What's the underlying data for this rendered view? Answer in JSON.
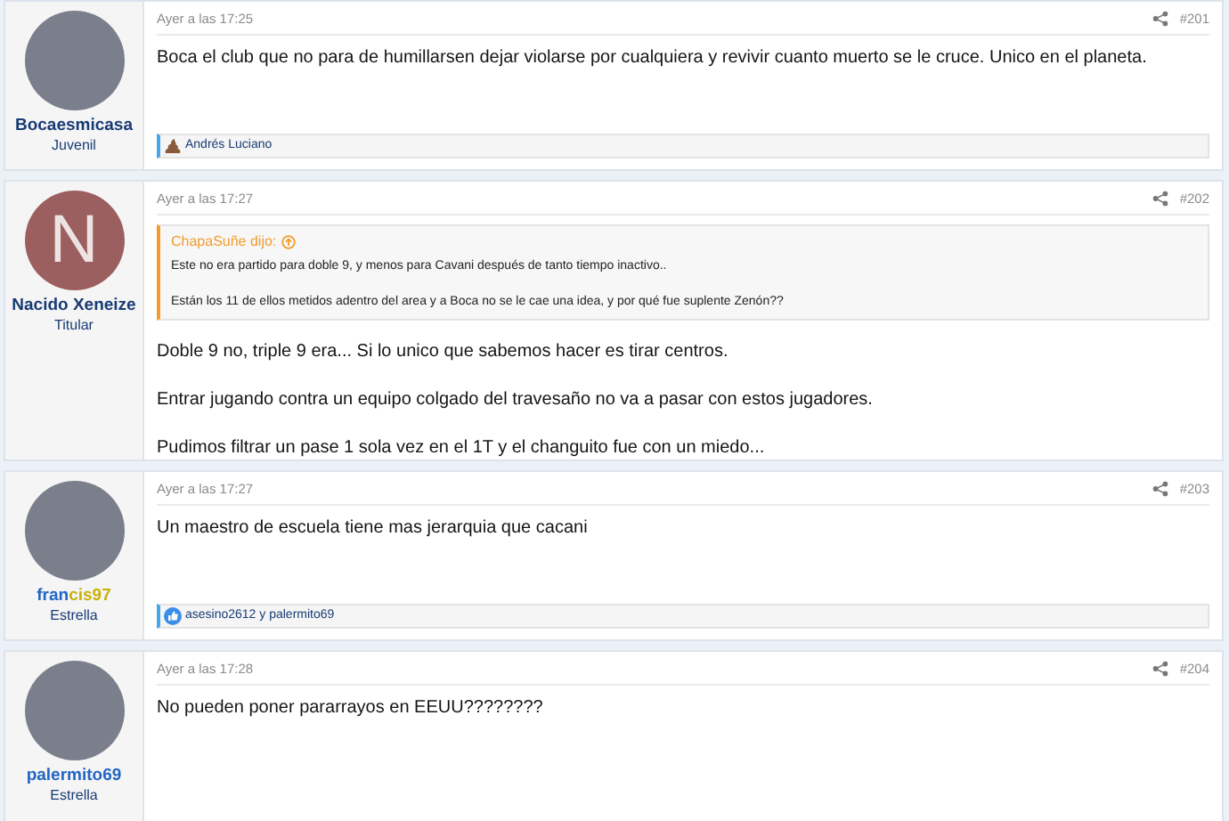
{
  "posts": [
    {
      "avatar": {
        "kind": "photo"
      },
      "username": [
        {
          "text": "Bocaesmicasa",
          "color": "#183b74"
        }
      ],
      "rank": "Juvenil",
      "time": "Ayer a las 17:25",
      "number": "#201",
      "paragraphs": [
        "Boca el club que no para de humillarsen dejar violarse por cualquiera y revivir cuanto muerto se le cruce. Unico en el planeta."
      ],
      "reactions": {
        "kind": "poo",
        "text": "Andrés Luciano"
      }
    },
    {
      "avatar": {
        "kind": "letter",
        "letter": "N"
      },
      "username": [
        {
          "text": "Nacido Xeneize",
          "color": "#183b74"
        }
      ],
      "rank": "Titular",
      "time": "Ayer a las 17:27",
      "number": "#202",
      "quote": {
        "author": "ChapaSuñe dijo:",
        "lines": [
          "Este no era partido para doble 9, y menos para Cavani después de tanto tiempo inactivo..",
          "Están los 11 de ellos metidos adentro del area y a Boca no se le cae una idea, y por qué fue suplente Zenón??"
        ]
      },
      "paragraphs": [
        "Doble 9 no, triple 9 era... Si lo unico que sabemos hacer es tirar centros.",
        "Entrar jugando contra un equipo colgado del travesaño no va a pasar con estos jugadores.",
        "Pudimos filtrar un pase 1 sola vez en el 1T y el changuito fue con un miedo..."
      ]
    },
    {
      "avatar": {
        "kind": "photo"
      },
      "username": [
        {
          "text": "fran",
          "color": "#2366c4"
        },
        {
          "text": "cis97",
          "color": "#c9b10a"
        }
      ],
      "rank": "Estrella",
      "time": "Ayer a las 17:27",
      "number": "#203",
      "paragraphs": [
        "Un maestro de escuela tiene mas jerarquia que cacani"
      ],
      "reactions": {
        "kind": "like",
        "text": "asesino2612 y palermito69"
      }
    },
    {
      "avatar": {
        "kind": "photo"
      },
      "username": [
        {
          "text": "palermito69",
          "color": "#2366c4"
        }
      ],
      "rank": "Estrella",
      "time": "Ayer a las 17:28",
      "number": "#204",
      "paragraphs": [
        "No pueden poner pararrayos en EEUU????????"
      ]
    }
  ]
}
